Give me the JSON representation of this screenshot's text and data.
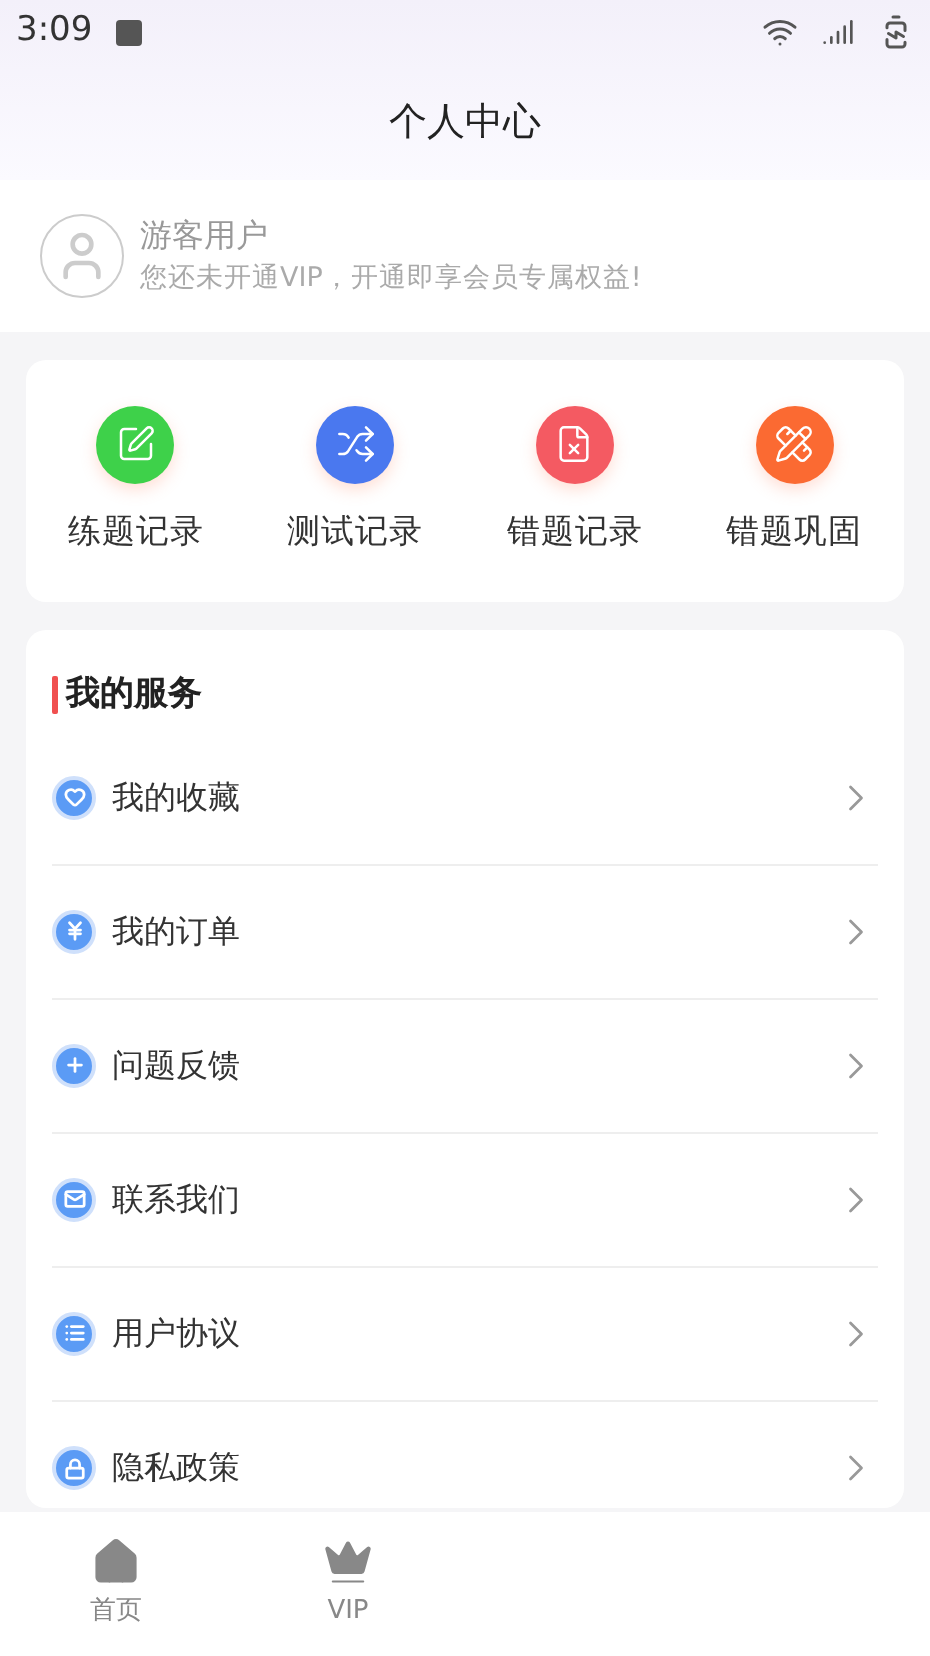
{
  "status_bar": {
    "time": "3:09"
  },
  "header": {
    "title": "个人中心"
  },
  "profile": {
    "name": "游客用户",
    "subtitle": "您还未开通VIP，开通即享会员专属权益!"
  },
  "quick_actions": [
    {
      "label": "练题记录",
      "kind": "practice",
      "color": "#3ed14a"
    },
    {
      "label": "测试记录",
      "kind": "shuffle",
      "color": "#4a78ef"
    },
    {
      "label": "错题记录",
      "kind": "wrong",
      "color": "#f45a62"
    },
    {
      "label": "错题巩固",
      "kind": "tools",
      "color": "#fb6a32"
    }
  ],
  "services": {
    "title": "我的服务",
    "items": [
      {
        "label": "我的收藏",
        "kind": "favorite"
      },
      {
        "label": "我的订单",
        "kind": "order"
      },
      {
        "label": "问题反馈",
        "kind": "feedback"
      },
      {
        "label": "联系我们",
        "kind": "contact"
      },
      {
        "label": "用户协议",
        "kind": "agreement"
      },
      {
        "label": "隐私政策",
        "kind": "privacy"
      }
    ]
  },
  "bottom_nav": [
    {
      "label": "首页",
      "kind": "home",
      "selected": false
    },
    {
      "label": "VIP",
      "kind": "vip",
      "selected": false
    }
  ]
}
